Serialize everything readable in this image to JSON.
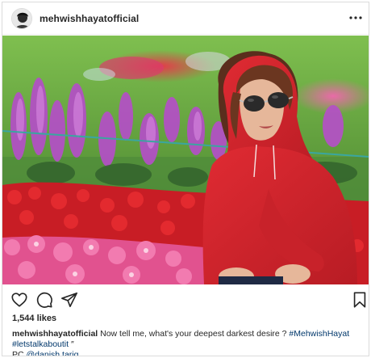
{
  "post": {
    "username": "mehwishhayatofficial",
    "more_icon": "more-horizontal-icon",
    "likes": "1,544 likes",
    "caption": {
      "username": "mehwishhayatofficial",
      "text": "Now tell me, what's your deepest darkest desire ?",
      "hashtag_1": "#MehwishHayat",
      "hashtag_2": "#letstalkaboutit",
      "hashtag_2_suffix": "″",
      "credit_prefix": "PC",
      "credit_mention": "@danish.tariq"
    },
    "actions": {
      "like_icon": "heart-icon",
      "comment_icon": "comment-icon",
      "share_icon": "share-icon",
      "save_icon": "bookmark-icon"
    }
  },
  "colors": {
    "hoodie": "#d7262e",
    "grass": "#5d9a3b",
    "link": "#00376b",
    "border": "#dbdbdb"
  }
}
